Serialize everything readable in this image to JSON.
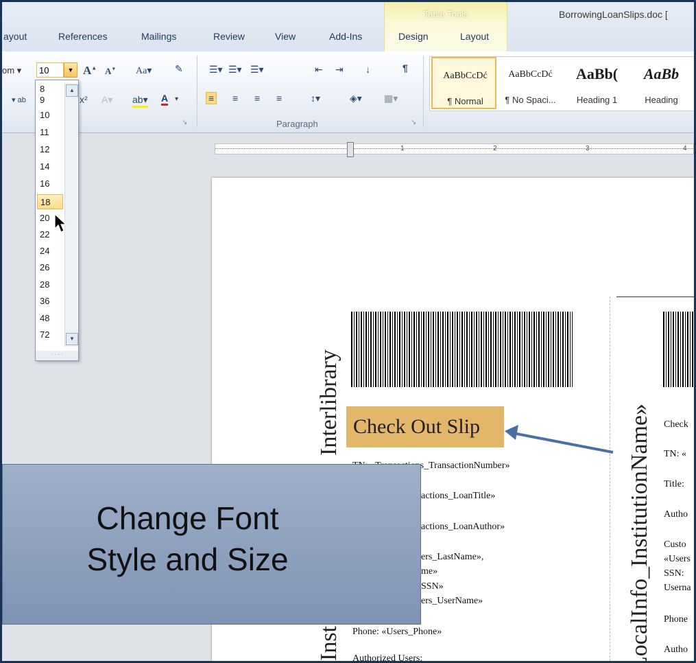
{
  "window": {
    "doc_title": "BorrowingLoanSlips.doc ["
  },
  "tabs": [
    "ayout",
    "References",
    "Mailings",
    "Review",
    "View",
    "Add-Ins"
  ],
  "table_tools": {
    "label": "Table Tools",
    "tabs": [
      "Design",
      "Layout"
    ]
  },
  "ribbon": {
    "font_name_partial": "om",
    "font_size_value": "10",
    "paragraph_group_label": "Paragraph",
    "styles": [
      {
        "preview": "AaBbCcDć",
        "label": "¶ Normal"
      },
      {
        "preview": "AaBbCcDć",
        "label": "¶ No Spaci..."
      },
      {
        "preview": "AaBb(",
        "label": "Heading 1"
      },
      {
        "preview": "AaBb",
        "label": "Heading"
      }
    ]
  },
  "font_size_dropdown": {
    "options": [
      "8",
      "9",
      "10",
      "11",
      "12",
      "14",
      "16",
      "18",
      "20",
      "22",
      "24",
      "26",
      "28",
      "36",
      "48",
      "72"
    ],
    "selected": "18"
  },
  "ruler": {
    "marks": [
      "1",
      "2",
      "3",
      "4"
    ]
  },
  "document": {
    "vertical_left": "Interlibrary",
    "vertical_left_bottom": "Inst",
    "vertical_right": "«LocalInfo_InstitutionName»",
    "heading": "Check Out Slip",
    "fields_left": [
      "TN: «Transactions_TransactionNumber»",
      "actions_LoanTitle»",
      "actions_LoanAuthor»",
      "ers_LastName»,",
      "me»",
      "SSN»",
      "ers_UserName»",
      "Phone: «Users_Phone»",
      "Authorized Users:"
    ],
    "fields_right": [
      "Check",
      "TN: «",
      "Title:",
      "Autho",
      "Custo",
      "«Users",
      "SSN:",
      "Userna",
      "Phone",
      "Autho"
    ]
  },
  "callout": {
    "line1": "Change Font",
    "line2": "Style and Size"
  },
  "colors": {
    "callout_bg": "#8fa2bf",
    "heading_bg": "#e2b76a",
    "arrow": "#4a6fa5",
    "frame": "#17335a"
  }
}
